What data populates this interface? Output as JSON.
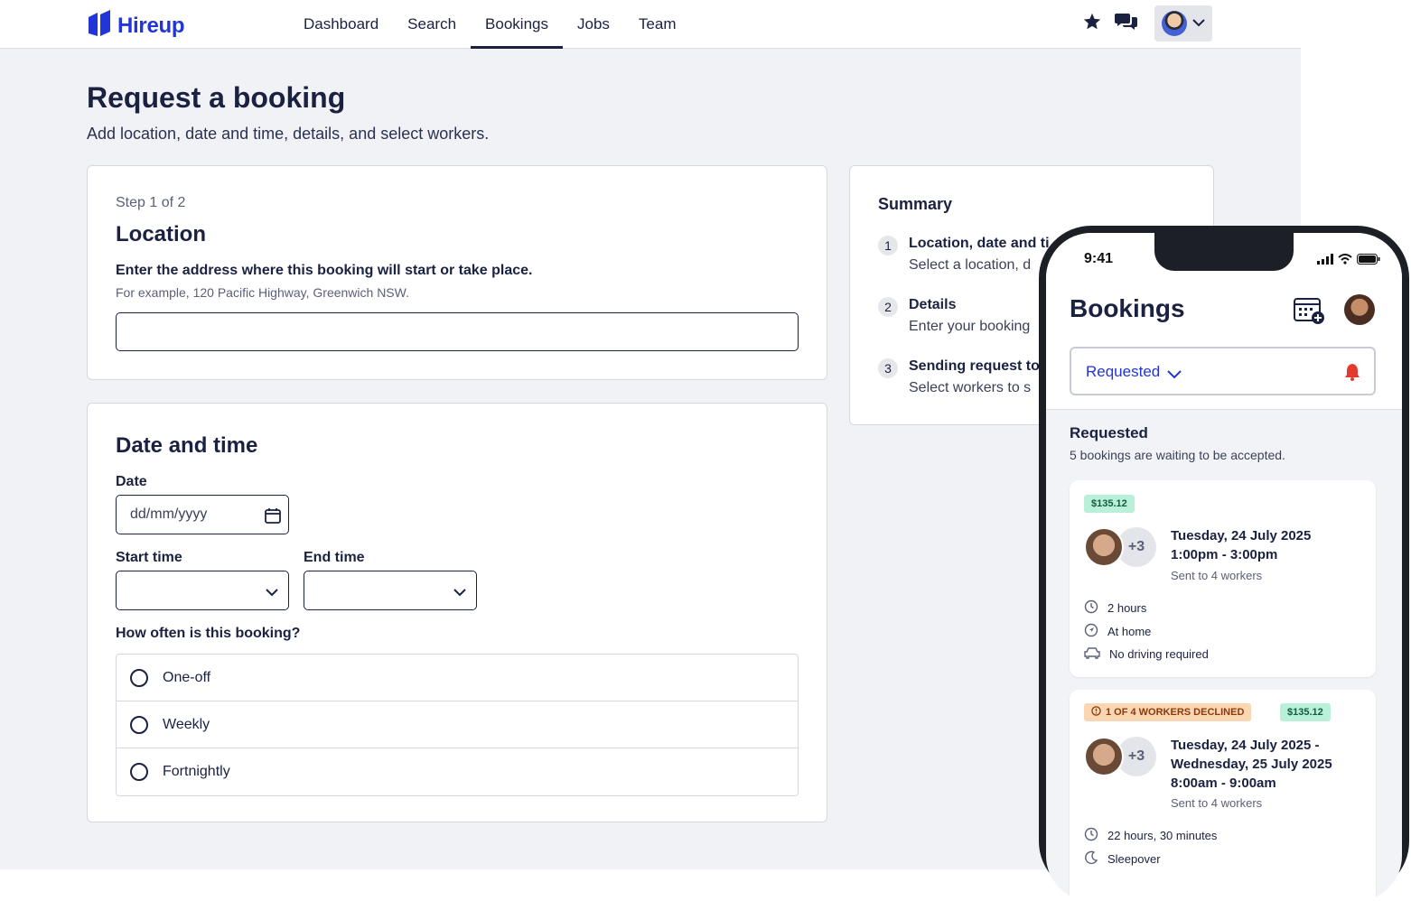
{
  "app": {
    "brand": "Hireup",
    "nav": [
      "Dashboard",
      "Search",
      "Bookings",
      "Jobs",
      "Team"
    ],
    "active_nav": "Bookings"
  },
  "page": {
    "title": "Request a booking",
    "subtitle": "Add location, date and time, details, and select workers."
  },
  "location": {
    "step": "Step 1 of 2",
    "title": "Location",
    "label": "Enter the address where this booking will start or take place.",
    "hint": "For example, 120 Pacific Highway, Greenwich NSW.",
    "value": ""
  },
  "datetime": {
    "title": "Date and time",
    "date_label": "Date",
    "date_placeholder": "dd/mm/yyyy",
    "start_label": "Start time",
    "end_label": "End time",
    "frequency_label": "How often is this booking?",
    "frequency_options": [
      "One-off",
      "Weekly",
      "Fortnightly"
    ]
  },
  "summary": {
    "title": "Summary",
    "items": [
      {
        "num": "1",
        "heading": "Location, date and ti",
        "desc": "Select a location, d"
      },
      {
        "num": "2",
        "heading": "Details",
        "desc": "Enter your booking"
      },
      {
        "num": "3",
        "heading": "Sending request to",
        "desc": "Select workers to s"
      }
    ]
  },
  "phone": {
    "time": "9:41",
    "title": "Bookings",
    "filter": "Requested",
    "section_title": "Requested",
    "section_desc": "5 bookings are waiting to be accepted.",
    "bookings": [
      {
        "price": "$135.12",
        "extra_workers": "+3",
        "date_lines": [
          "Tuesday, 24 July 2025",
          "1:00pm - 3:00pm"
        ],
        "sent": "Sent to 4 workers",
        "meta": [
          {
            "icon": "clock-icon",
            "text": "2 hours"
          },
          {
            "icon": "navigation-icon",
            "text": "At home"
          },
          {
            "icon": "car-icon",
            "text": "No driving required"
          }
        ]
      },
      {
        "warning": "1 OF 4 WORKERS DECLINED",
        "price": "$135.12",
        "extra_workers": "+3",
        "date_lines": [
          "Tuesday, 24 July 2025 -",
          "Wednesday, 25 July 2025",
          "8:00am - 9:00am"
        ],
        "sent": "Sent to 4 workers",
        "meta": [
          {
            "icon": "clock-icon",
            "text": "22 hours, 30 minutes"
          },
          {
            "icon": "moon-icon",
            "text": "Sleepover"
          }
        ]
      }
    ]
  },
  "colors": {
    "brand": "#2235d8",
    "text": "#1b2140",
    "background": "#f1f2f6",
    "price_badge": "#b8f0da",
    "warning_badge": "#fbd6b3",
    "alert": "#e23b2e"
  }
}
